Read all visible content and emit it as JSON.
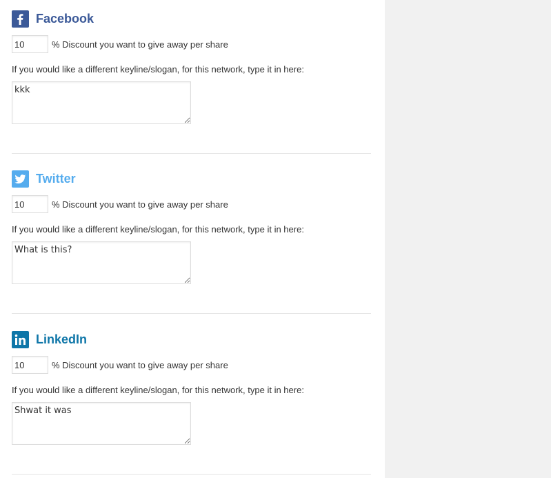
{
  "networks": [
    {
      "key": "facebook",
      "title": "Facebook",
      "title_color": "#3b5998",
      "icon_color": "#3b5998",
      "discount_value": "10",
      "discount_label": "% Discount you want to give away per share",
      "keyline_label": "If you would like a different keyline/slogan, for this network, type it in here:",
      "keyline_value": "kkk"
    },
    {
      "key": "twitter",
      "title": "Twitter",
      "title_color": "#55acee",
      "icon_color": "#55acee",
      "discount_value": "10",
      "discount_label": "% Discount you want to give away per share",
      "keyline_label": "If you would like a different keyline/slogan, for this network, type it in here:",
      "keyline_value": "What is this?"
    },
    {
      "key": "linkedin",
      "title": "LinkedIn",
      "title_color": "#0e76a8",
      "icon_color": "#0e76a8",
      "discount_value": "10",
      "discount_label": "% Discount you want to give away per share",
      "keyline_label": "If you would like a different keyline/slogan, for this network, type it in here:",
      "keyline_value": "Shwat it was"
    }
  ],
  "icons": {
    "facebook": "facebook-icon",
    "twitter": "twitter-icon",
    "linkedin": "linkedin-icon"
  }
}
